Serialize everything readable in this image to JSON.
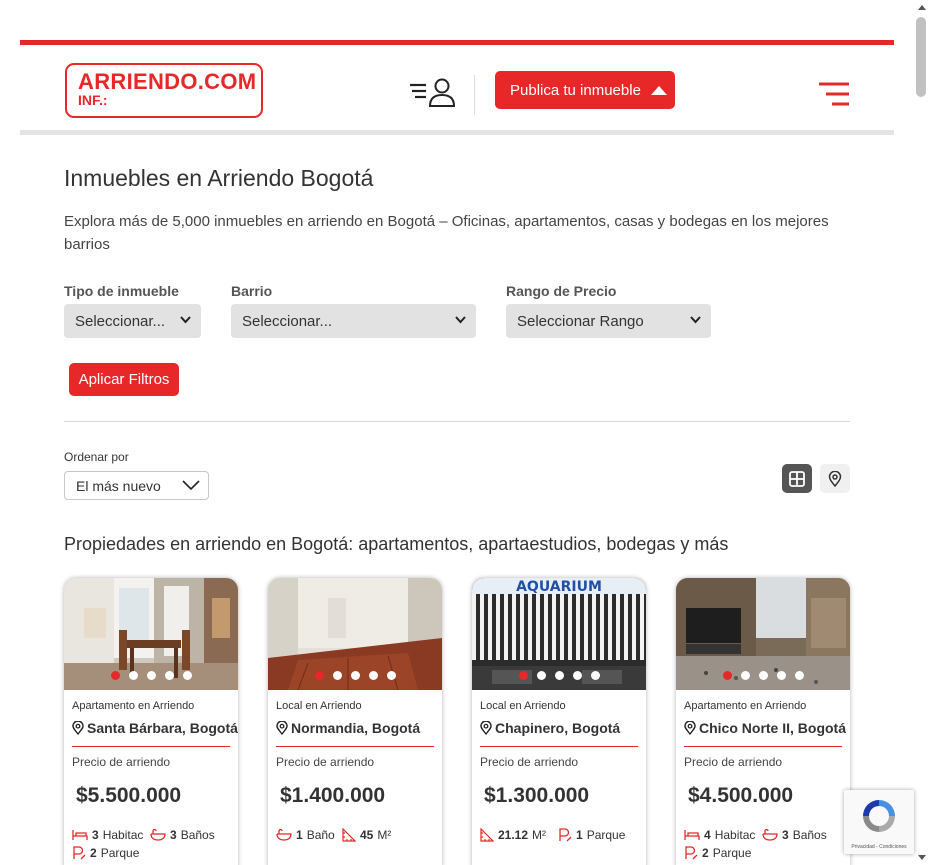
{
  "header": {
    "logo_line1": "ARRIENDO.COM",
    "logo_line2": "INF.:",
    "publish_label": "Publica tu inmueble"
  },
  "page": {
    "title": "Inmuebles en Arriendo Bogotá",
    "intro": "Explora más de 5,000 inmuebles en arriendo en Bogotá – Oficinas, apartamentos, casas y bodegas en los mejores barrios"
  },
  "filters": {
    "type_label": "Tipo de inmueble",
    "type_value": "Seleccionar...",
    "barrio_label": "Barrio",
    "barrio_value": "Seleccionar...",
    "price_label": "Rango de Precio",
    "price_value": "Seleccionar Rango",
    "apply_label": "Aplicar Filtros"
  },
  "sort": {
    "label": "Ordenar por",
    "value": "El más nuevo"
  },
  "section_title": "Propiedades en arriendo en Bogotá: apartamentos, apartaestudios, bodegas y más",
  "price_caption": "Precio de arriendo",
  "listings": [
    {
      "type": "Apartamento en Arriendo",
      "location": "Santa Bárbara, Bogotá",
      "price": "$5.500.000",
      "features": [
        {
          "icon": "bed-icon",
          "value": "3",
          "unit": "Habitac"
        },
        {
          "icon": "bath-icon",
          "value": "3",
          "unit": "Baños"
        },
        {
          "icon": "parking-icon",
          "value": "2",
          "unit": "Parque"
        }
      ]
    },
    {
      "type": "Local en Arriendo",
      "location": "Normandia, Bogotá",
      "price": "$1.400.000",
      "features": [
        {
          "icon": "bath-icon",
          "value": "1",
          "unit": "Baño"
        },
        {
          "icon": "area-icon",
          "value": "45",
          "unit": "M²"
        }
      ]
    },
    {
      "type": "Local en Arriendo",
      "location": "Chapinero, Bogotá",
      "price": "$1.300.000",
      "features": [
        {
          "icon": "area-icon",
          "value": "21.12",
          "unit": "M²"
        },
        {
          "icon": "parking-icon",
          "value": "1",
          "unit": "Parque"
        }
      ]
    },
    {
      "type": "Apartamento en Arriendo",
      "location": "Chico Norte II, Bogotá",
      "price": "$4.500.000",
      "features": [
        {
          "icon": "bed-icon",
          "value": "4",
          "unit": "Habitac"
        },
        {
          "icon": "bath-icon",
          "value": "3",
          "unit": "Baños"
        },
        {
          "icon": "parking-icon",
          "value": "2",
          "unit": "Parque"
        }
      ]
    }
  ],
  "photo3_sign": "AQUARIUM",
  "recaptcha_text": "Privacidad - Condiciones",
  "colors": {
    "brand_red": "#e82828",
    "dark_button": "#555555"
  }
}
